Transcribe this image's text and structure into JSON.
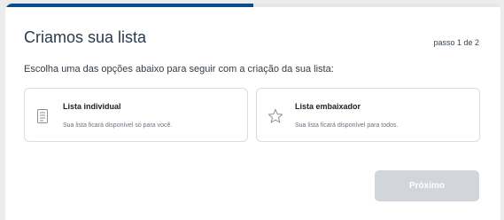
{
  "modal": {
    "title": "Criamos sua lista",
    "step_label": "passo 1 de 2",
    "progress": 0.5,
    "instruction": "Escolha uma das opções abaixo para seguir com a criação da sua lista:"
  },
  "options": [
    {
      "icon": "list-document-icon",
      "title": "Lista individual",
      "description": "Sua lista ficará disponível só para você."
    },
    {
      "icon": "star-icon",
      "title": "Lista embaixador",
      "description": "Sua lista ficará disponível para todos."
    }
  ],
  "footer": {
    "next_label": "Próximo"
  },
  "colors": {
    "progress": "#0a4d8c",
    "disabled_button": "#d2d5d9"
  }
}
